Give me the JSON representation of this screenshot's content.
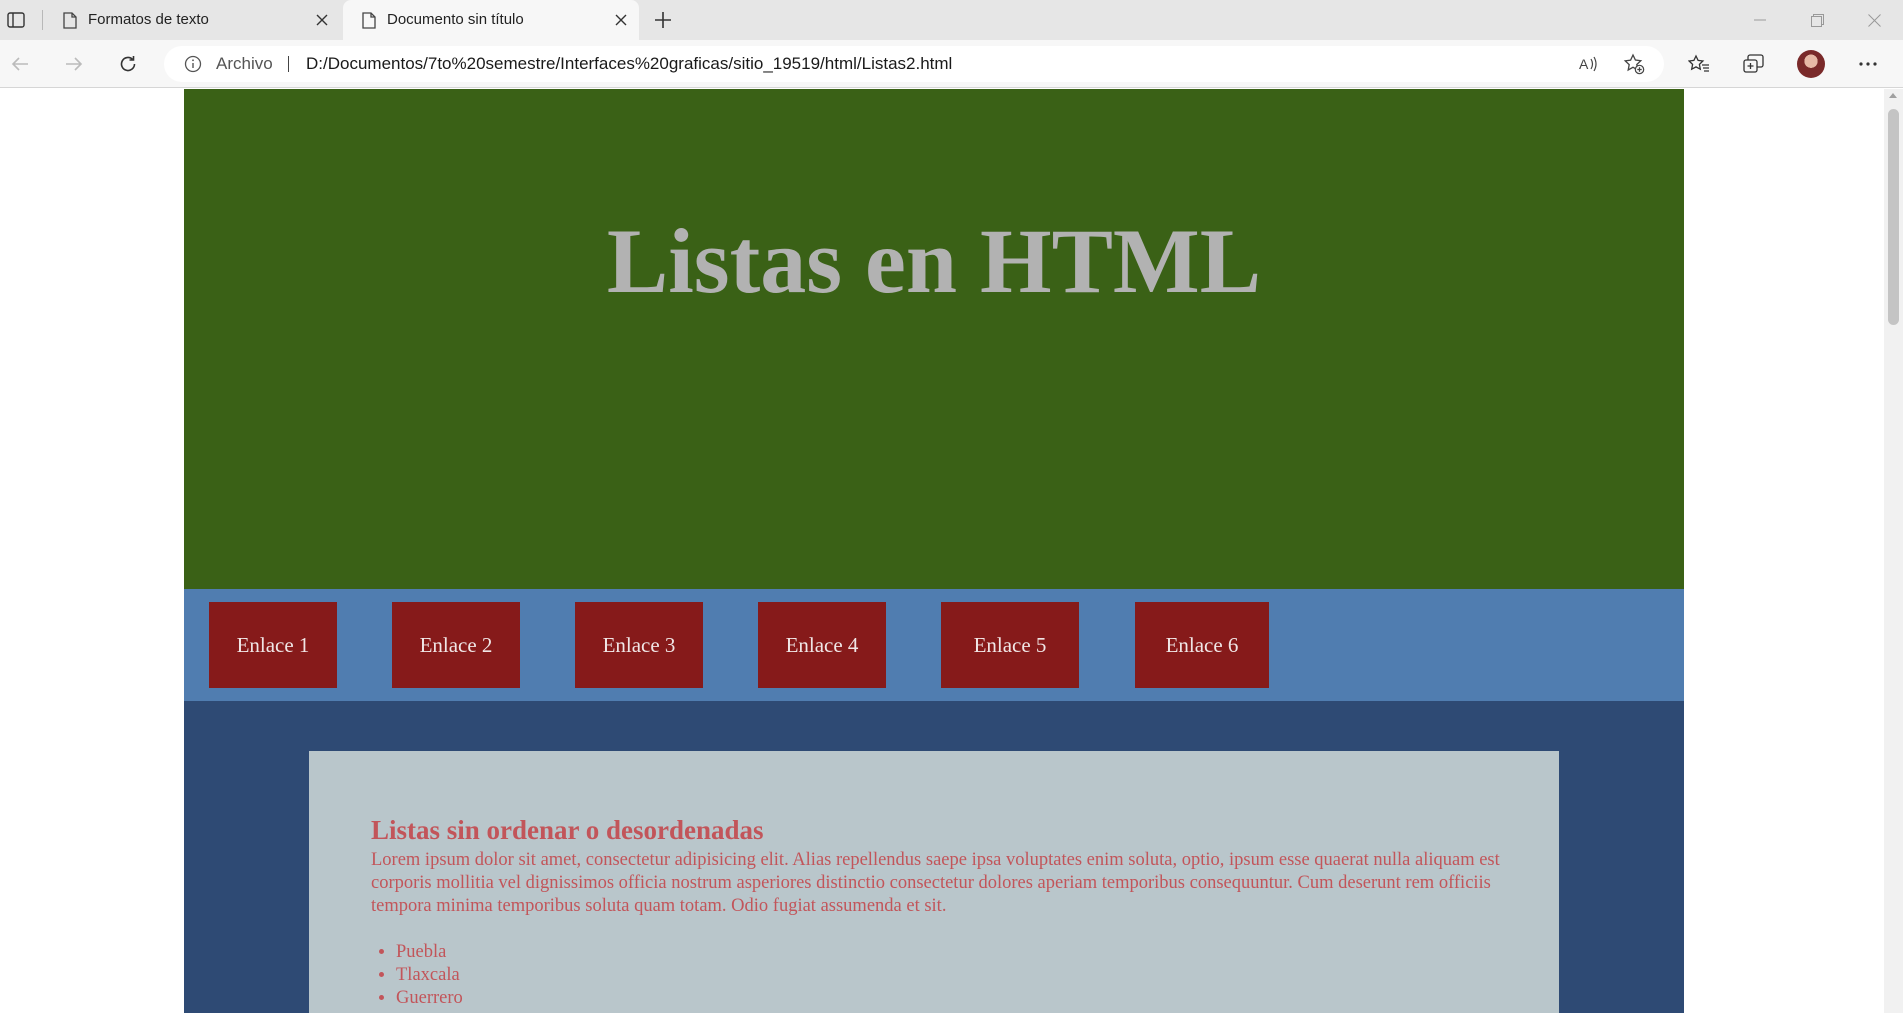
{
  "browser": {
    "tabs": [
      {
        "title": "Formatos de texto",
        "active": false
      },
      {
        "title": "Documento sin título",
        "active": true
      }
    ],
    "address_bar": {
      "site_label": "Archivo",
      "url": "D:/Documentos/7to%20semestre/Interfaces%20graficas/sitio_19519/html/Listas2.html"
    },
    "icons": [
      "tab-actions-icon",
      "page-icon",
      "close-icon",
      "plus-icon",
      "minimize-icon",
      "restore-icon",
      "back-arrow-icon",
      "forward-arrow-icon",
      "refresh-icon",
      "info-icon",
      "read-aloud-icon",
      "add-favorite-icon",
      "favorites-icon",
      "collections-icon",
      "profile-avatar",
      "more-icon"
    ]
  },
  "page": {
    "hero": {
      "title": "Listas en HTML"
    },
    "nav_links": [
      "Enlace 1",
      "Enlace 2",
      "Enlace 3",
      "Enlace 4",
      "Enlace 5",
      "Enlace 6"
    ],
    "section": {
      "heading": "Listas sin ordenar o desordenadas",
      "paragraph": "Lorem ipsum dolor sit amet, consectetur adipisicing elit. Alias repellendus saepe ipsa voluptates enim soluta, optio, ipsum esse quaerat nulla aliquam est corporis mollitia vel dignissimos officia nostrum asperiores distinctio consectetur dolores aperiam temporibus consequuntur. Cum deserunt rem officiis tempora minima temporibus soluta quam totam. Odio fugiat assumenda et sit.",
      "list_items": [
        "Puebla",
        "Tlaxcala",
        "Guerrero"
      ]
    },
    "colors": {
      "hero_bg": "#3a6116",
      "hero_title": "#b2b2b2",
      "nav_bg": "#507db0",
      "nav_link_bg": "#861a1a",
      "content_bg": "#2e4a74",
      "card_bg": "#b9c6cb",
      "text_accent": "#c2555a"
    }
  }
}
